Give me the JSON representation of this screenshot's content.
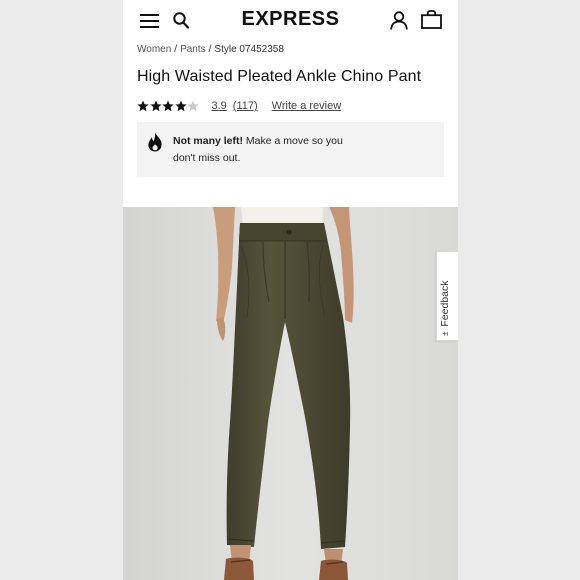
{
  "header": {
    "brand": "EXPRESS",
    "menu_icon": "hamburger-menu-icon",
    "search_icon": "search-icon",
    "account_icon": "user-account-icon",
    "bag_icon": "shopping-bag-icon"
  },
  "breadcrumb": {
    "items": [
      "Women",
      "Pants"
    ],
    "separator": "/",
    "style": "Style 07452358"
  },
  "product": {
    "title": "High Waisted Pleated Ankle Chino Pant",
    "rating": 3.9,
    "rating_label": "3.9",
    "stars_filled": 4,
    "stars_total": 5,
    "review_count": "(117)",
    "write_review": "Write a review"
  },
  "stock_notice": {
    "icon": "flame-icon",
    "bold": "Not many left!",
    "text": " Make a move so you don't miss out."
  },
  "feedback": {
    "label": "Feedback",
    "icon": "plus-minus-icon"
  },
  "colors": {
    "pant_olive": "#4f4c36",
    "top_white": "#f4f1ea",
    "photo_bg": "#dcdcda",
    "notice_bg": "#f3f3f3"
  }
}
